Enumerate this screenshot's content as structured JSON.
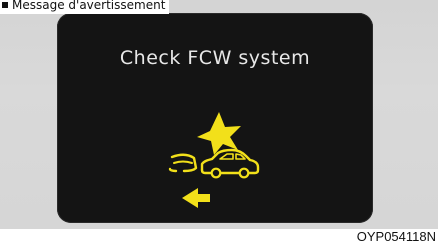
{
  "caption": {
    "text": "Message d'avertissement"
  },
  "display": {
    "message": "Check FCW system",
    "icon": "forward-collision-warning-icon",
    "background_color": "#141414",
    "text_color": "#e8e8e8",
    "icon_color": "#f2e01a"
  },
  "figure": {
    "code": "OYP054118N"
  }
}
